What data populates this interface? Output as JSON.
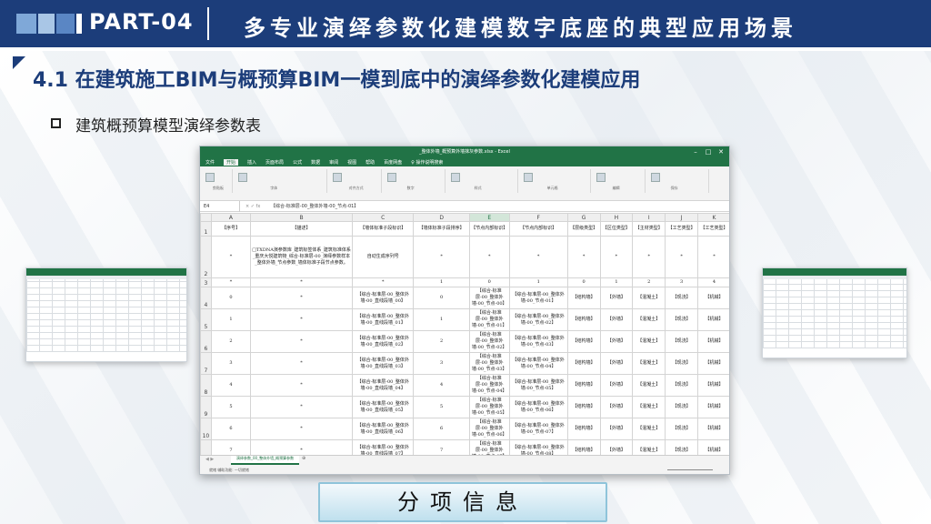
{
  "header": {
    "part": "PART-04",
    "title": "多专业演绎参数化建模数字底座的典型应用场景"
  },
  "subtitle": "4.1 在建筑施工BIM与概预算BIM一模到底中的演绎参数化建模应用",
  "bullet": "建筑概预算模型演绎参数表",
  "excel": {
    "window_title": "_整体外墙_概预算外墙抹灰参数.xlsx - Excel",
    "tabs": [
      "文件",
      "开始",
      "插入",
      "页面布局",
      "公式",
      "数据",
      "审阅",
      "视图",
      "帮助",
      "百度网盘",
      "♀ 操作说明搜索"
    ],
    "active_tab": "开始",
    "ribbon_groups": [
      "剪贴板",
      "字体",
      "对齐方式",
      "数字",
      "样式",
      "单元格",
      "编辑",
      "保存"
    ],
    "name_box": "E4",
    "formula": "【综合-标准层-00_整体外墙-00_节点-01】",
    "columns": [
      "A",
      "B",
      "C",
      "D",
      "E",
      "F",
      "G",
      "H",
      "I",
      "J",
      "K"
    ],
    "rows": [
      {
        "n": "1",
        "cells": [
          "【序号】",
          "【描述】",
          "【墙体标准子段标识】",
          "【墙体标准子段排序】",
          "【节点内部标识】",
          "【节点内部标识】",
          "【层级类型】",
          "【区位类型】",
          "【主材类型】",
          "【工艺类型】",
          "【工艺类型】"
        ]
      },
      {
        "n": "2",
        "cells": [
          "*",
          "□TXDNA演参数库_建筑标签体系_建筑标准体系_重庆大悦建筑物_综合-标准层-00_演绎参数样本_整体外墙_节点参数_墙体标准子段节点参数。",
          "自动生成序列号",
          "*",
          "*",
          "*",
          "*",
          "*",
          "*",
          "*",
          "*"
        ]
      },
      {
        "n": "3",
        "cells": [
          "*",
          "*",
          "*",
          "1",
          "0",
          "1",
          "0",
          "1",
          "2",
          "3",
          "4"
        ]
      },
      {
        "n": "4",
        "cells": [
          "0",
          "*",
          "【综合-标准层-00_整体外墙-00_直线段墙_00】",
          "0",
          "【综合-标准层-00_整体外墙-00_节点-00】",
          "【综合-标准层-00_整体外墙-00_节点-01】",
          "【结构墙】",
          "【外墙】",
          "【混凝土】",
          "【现浇】",
          "【机械】"
        ]
      },
      {
        "n": "5",
        "cells": [
          "1",
          "*",
          "【综合-标准层-00_整体外墙-00_直线段墙_01】",
          "1",
          "【综合-标准层-00_整体外墙-00_节点-01】",
          "【综合-标准层-00_整体外墙-00_节点-02】",
          "【结构墙】",
          "【外墙】",
          "【混凝土】",
          "【现浇】",
          "【机械】"
        ]
      },
      {
        "n": "6",
        "cells": [
          "2",
          "*",
          "【综合-标准层-00_整体外墙-00_直线段墙_02】",
          "2",
          "【综合-标准层-00_整体外墙-00_节点-02】",
          "【综合-标准层-00_整体外墙-00_节点-03】",
          "【结构墙】",
          "【外墙】",
          "【混凝土】",
          "【现浇】",
          "【机械】"
        ]
      },
      {
        "n": "7",
        "cells": [
          "3",
          "*",
          "【综合-标准层-00_整体外墙-00_直线段墙_03】",
          "3",
          "【综合-标准层-00_整体外墙-00_节点-03】",
          "【综合-标准层-00_整体外墙-00_节点-04】",
          "【结构墙】",
          "【外墙】",
          "【混凝土】",
          "【现浇】",
          "【机械】"
        ]
      },
      {
        "n": "8",
        "cells": [
          "4",
          "*",
          "【综合-标准层-00_整体外墙-00_直线段墙_04】",
          "4",
          "【综合-标准层-00_整体外墙-00_节点-04】",
          "【综合-标准层-00_整体外墙-00_节点-05】",
          "【结构墙】",
          "【外墙】",
          "【混凝土】",
          "【现浇】",
          "【机械】"
        ]
      },
      {
        "n": "9",
        "cells": [
          "5",
          "*",
          "【综合-标准层-00_整体外墙-00_直线段墙_05】",
          "5",
          "【综合-标准层-00_整体外墙-00_节点-05】",
          "【综合-标准层-00_整体外墙-00_节点-06】",
          "【结构墙】",
          "【外墙】",
          "【混凝土】",
          "【现浇】",
          "【机械】"
        ]
      },
      {
        "n": "10",
        "cells": [
          "6",
          "*",
          "【综合-标准层-00_整体外墙-00_直线段墙_06】",
          "6",
          "【综合-标准层-00_整体外墙-00_节点-06】",
          "【综合-标准层-00_整体外墙-00_节点-07】",
          "【结构墙】",
          "【外墙】",
          "【混凝土】",
          "【现浇】",
          "【机械】"
        ]
      },
      {
        "n": "11",
        "cells": [
          "7",
          "*",
          "【综合-标准层-00_整体外墙-00_直线段墙_07】",
          "7",
          "【综合-标准层-00_整体外墙-00_节点-07】",
          "【综合-标准层-00_整体外墙-00_节点-08】",
          "【结构墙】",
          "【外墙】",
          "【混凝土】",
          "【现浇】",
          "【机械】"
        ]
      }
    ],
    "row_labels": [
      "1",
      "2",
      "3",
      "4",
      "5",
      "6",
      "7",
      "8",
      "9",
      "10",
      "11"
    ],
    "sheet_tab": "演绎参数_00_整体外墙_概预算参数",
    "status": "就绪  辅助功能: 一切就绪"
  },
  "button": "分项信息",
  "colors": {
    "brand": "#1c3d7a",
    "excel": "#217346"
  }
}
